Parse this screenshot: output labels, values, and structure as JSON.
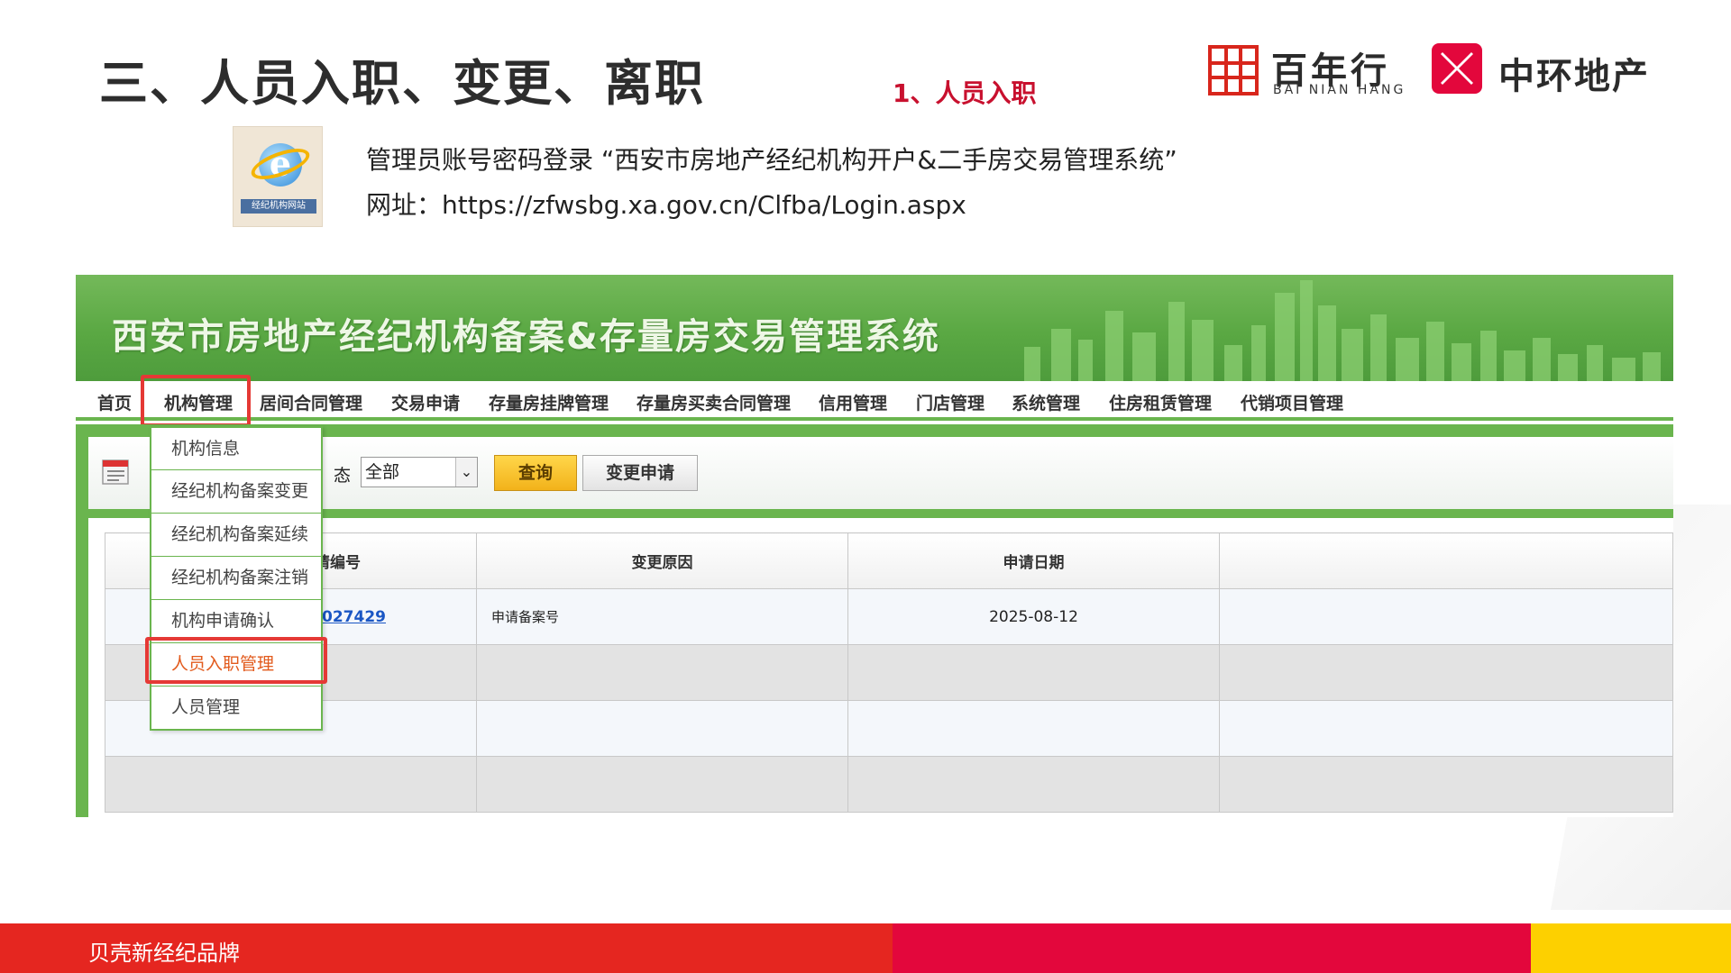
{
  "slide": {
    "title": "三、人员入职、变更、离职",
    "subtitle": "1、人员入职",
    "info_line1": "管理员账号密码登录 “西安市房地产经纪机构开户&二手房交易管理系统”",
    "info_line2": "网址：https://zfwsbg.xa.gov.cn/Clfba/Login.aspx",
    "footer_text": "贝壳新经纪品牌"
  },
  "logos": {
    "bnh_cn": "百年行",
    "bnh_en": "BAI NIAN HANG",
    "zh_cn": "中环地产"
  },
  "desktop_icon": {
    "label": "经纪机构网站",
    "icon": "ie-browser-icon"
  },
  "system": {
    "title": "西安市房地产经纪机构备案&存量房交易管理系统",
    "nav": [
      "首页",
      "机构管理",
      "居间合同管理",
      "交易申请",
      "存量房挂牌管理",
      "存量房买卖合同管理",
      "信用管理",
      "门店管理",
      "系统管理",
      "住房租赁管理",
      "代销项目管理"
    ],
    "dropdown": [
      "机构信息",
      "经纪机构备案变更",
      "经纪机构备案延续",
      "经纪机构备案注销",
      "机构申请确认",
      "人员入职管理",
      "人员管理"
    ],
    "toolbar": {
      "status_label": "态",
      "status_value": "全部",
      "query_button": "查询",
      "change_button": "变更申请"
    },
    "table": {
      "headers": [
        "请编号",
        "变更原因",
        "申请日期",
        ""
      ],
      "rows": [
        {
          "id": "027429",
          "reason": "申请备案号",
          "date": "2025-08-12"
        }
      ]
    }
  },
  "colors": {
    "accent_red": "#c8102e",
    "system_green": "#6ab54e",
    "footer_red": "#e52620",
    "footer_yellow": "#fdd000"
  }
}
